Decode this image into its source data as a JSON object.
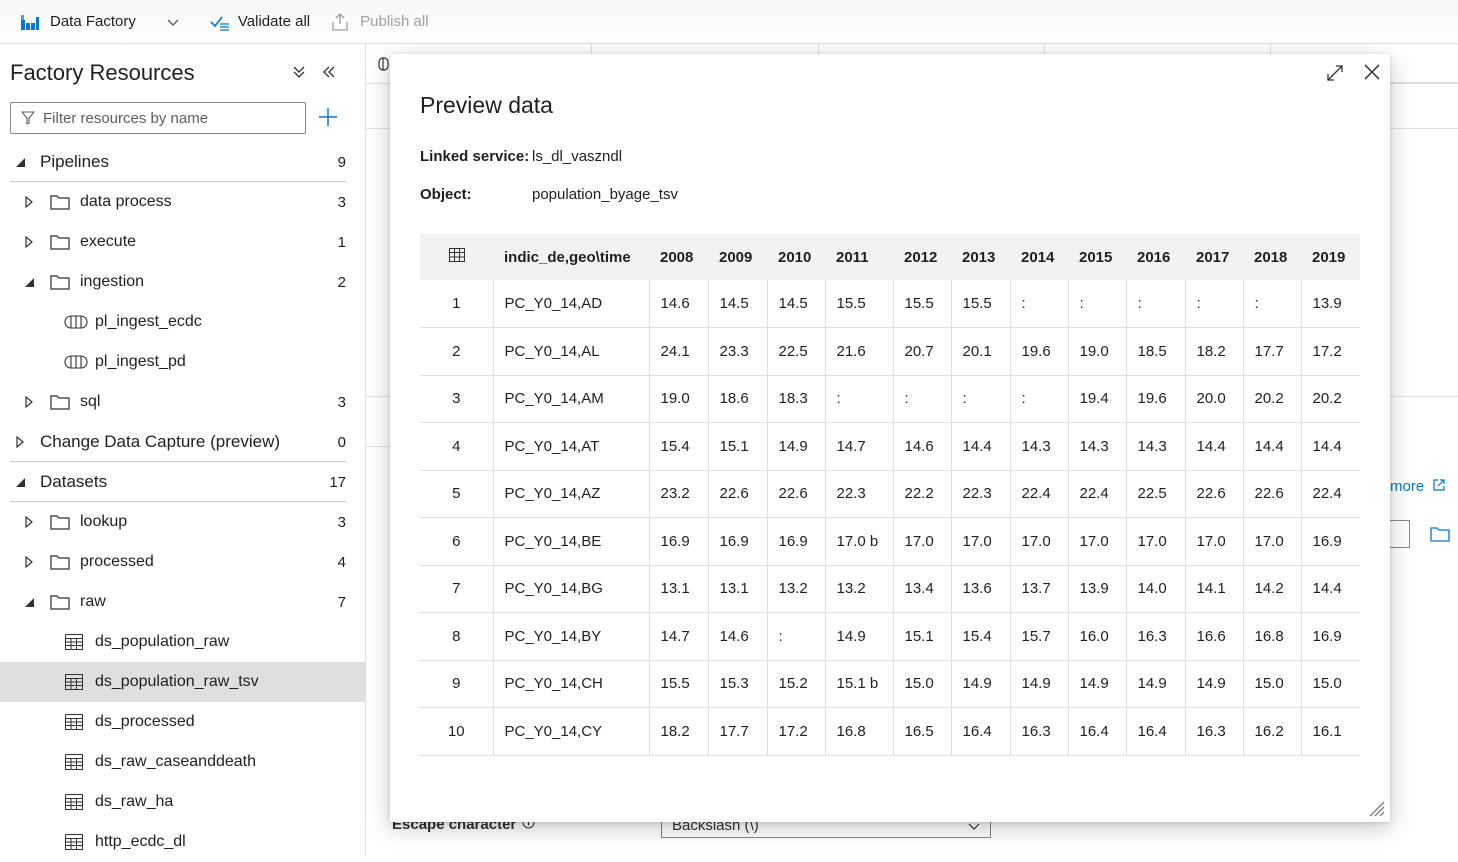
{
  "toolbar": {
    "app_name": "Data Factory",
    "validate_label": "Validate all",
    "publish_label": "Publish all"
  },
  "left_panel": {
    "title": "Factory Resources",
    "filter_placeholder": "Filter resources by name",
    "tree": [
      {
        "type": "section",
        "label": "Pipelines",
        "count": "9",
        "expanded": true
      },
      {
        "type": "folder",
        "label": "data process",
        "count": "3",
        "expanded": false
      },
      {
        "type": "folder",
        "label": "execute",
        "count": "1",
        "expanded": false
      },
      {
        "type": "folder",
        "label": "ingestion",
        "count": "2",
        "expanded": true
      },
      {
        "type": "pipeline",
        "label": "pl_ingest_ecdc"
      },
      {
        "type": "pipeline",
        "label": "pl_ingest_pd"
      },
      {
        "type": "folder",
        "label": "sql",
        "count": "3",
        "expanded": false
      },
      {
        "type": "section",
        "label": "Change Data Capture (preview)",
        "count": "0",
        "expanded": false
      },
      {
        "type": "section",
        "label": "Datasets",
        "count": "17",
        "expanded": true
      },
      {
        "type": "folder",
        "label": "lookup",
        "count": "3",
        "expanded": false
      },
      {
        "type": "folder",
        "label": "processed",
        "count": "4",
        "expanded": false
      },
      {
        "type": "folder",
        "label": "raw",
        "count": "7",
        "expanded": true
      },
      {
        "type": "dataset",
        "label": "ds_population_raw"
      },
      {
        "type": "dataset",
        "label": "ds_population_raw_tsv",
        "selected": true
      },
      {
        "type": "dataset",
        "label": "ds_processed"
      },
      {
        "type": "dataset",
        "label": "ds_raw_caseanddeath"
      },
      {
        "type": "dataset",
        "label": "ds_raw_ha"
      },
      {
        "type": "dataset",
        "label": "http_ecdc_dl"
      }
    ]
  },
  "background": {
    "learn_more": "more",
    "escape_label": "Escape character",
    "escape_value": "Backslash (\\)"
  },
  "modal": {
    "title": "Preview data",
    "linked_service_label": "Linked service:",
    "linked_service_value": "ls_dl_vaszndl",
    "object_label": "Object:",
    "object_value": "population_byage_tsv",
    "columns": [
      "indic_de,geo\\time",
      "2008",
      "2009",
      "2010",
      "2011",
      "2012",
      "2013",
      "2014",
      "2015",
      "2016",
      "2017",
      "2018",
      "2019"
    ],
    "rows": [
      {
        "n": "1",
        "cells": [
          "PC_Y0_14,AD",
          "14.6",
          "14.5",
          "14.5",
          "15.5",
          "15.5",
          "15.5",
          ":",
          ":",
          ":",
          ":",
          ":",
          "13.9"
        ]
      },
      {
        "n": "2",
        "cells": [
          "PC_Y0_14,AL",
          "24.1",
          "23.3",
          "22.5",
          "21.6",
          "20.7",
          "20.1",
          "19.6",
          "19.0",
          "18.5",
          "18.2",
          "17.7",
          "17.2"
        ]
      },
      {
        "n": "3",
        "cells": [
          "PC_Y0_14,AM",
          "19.0",
          "18.6",
          "18.3",
          ":",
          ":",
          ":",
          ":",
          "19.4",
          "19.6",
          "20.0",
          "20.2",
          "20.2"
        ]
      },
      {
        "n": "4",
        "cells": [
          "PC_Y0_14,AT",
          "15.4",
          "15.1",
          "14.9",
          "14.7",
          "14.6",
          "14.4",
          "14.3",
          "14.3",
          "14.3",
          "14.4",
          "14.4",
          "14.4"
        ]
      },
      {
        "n": "5",
        "cells": [
          "PC_Y0_14,AZ",
          "23.2",
          "22.6",
          "22.6",
          "22.3",
          "22.2",
          "22.3",
          "22.4",
          "22.4",
          "22.5",
          "22.6",
          "22.6",
          "22.4"
        ]
      },
      {
        "n": "6",
        "cells": [
          "PC_Y0_14,BE",
          "16.9",
          "16.9",
          "16.9",
          "17.0 b",
          "17.0",
          "17.0",
          "17.0",
          "17.0",
          "17.0",
          "17.0",
          "17.0",
          "16.9"
        ]
      },
      {
        "n": "7",
        "cells": [
          "PC_Y0_14,BG",
          "13.1",
          "13.1",
          "13.2",
          "13.2",
          "13.4",
          "13.6",
          "13.7",
          "13.9",
          "14.0",
          "14.1",
          "14.2",
          "14.4"
        ]
      },
      {
        "n": "8",
        "cells": [
          "PC_Y0_14,BY",
          "14.7",
          "14.6",
          ":",
          "14.9",
          "15.1",
          "15.4",
          "15.7",
          "16.0",
          "16.3",
          "16.6",
          "16.8",
          "16.9"
        ]
      },
      {
        "n": "9",
        "cells": [
          "PC_Y0_14,CH",
          "15.5",
          "15.3",
          "15.2",
          "15.1 b",
          "15.0",
          "14.9",
          "14.9",
          "14.9",
          "14.9",
          "14.9",
          "15.0",
          "15.0"
        ]
      },
      {
        "n": "10",
        "cells": [
          "PC_Y0_14,CY",
          "18.2",
          "17.7",
          "17.2",
          "16.8",
          "16.5",
          "16.4",
          "16.3",
          "16.4",
          "16.4",
          "16.3",
          "16.2",
          "16.1"
        ]
      }
    ]
  },
  "colors": {
    "accent": "#0078d4",
    "selected_row": "#e1dfdd",
    "header_bg": "#f3f2f1"
  }
}
